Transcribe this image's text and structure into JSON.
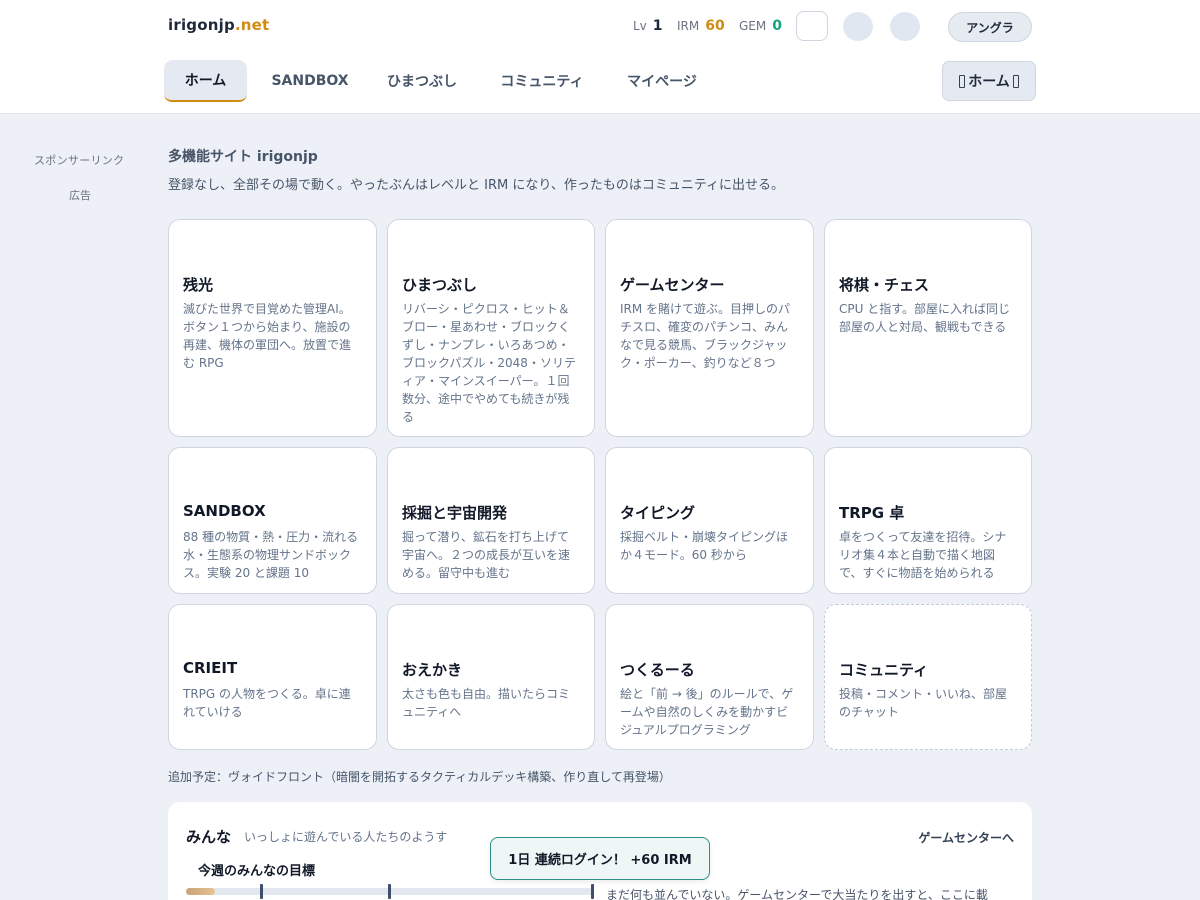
{
  "header": {
    "logo_main": "irigonjp",
    "logo_tld": ".net",
    "stats": {
      "lv_label": "Lv",
      "lv_value": "1",
      "irm_label": "IRM",
      "irm_value": "60",
      "gem_label": "GEM",
      "gem_value": "0"
    },
    "language_button": "アングラ",
    "nav": [
      "ホーム",
      "SANDBOX",
      "ひまつぶし",
      "コミュニティ",
      "マイページ"
    ],
    "active_nav": "ホーム",
    "home_dropdown": "ホーム"
  },
  "sidebar": {
    "sponsor_label": "スポンサーリンク",
    "ad_label": "広告"
  },
  "intro": {
    "title": "多機能サイト irigonjp",
    "description": "登録なし、全部その場で動く。やったぶんはレベルと IRM になり、作ったものはコミュニティに出せる。"
  },
  "cards": [
    {
      "title": "残光",
      "desc": "滅びた世界で目覚めた管理AI。ボタン１つから始まり、施設の再建、機体の軍団へ。放置で進む RPG"
    },
    {
      "title": "ひまつぶし",
      "desc": "リバーシ・ピクロス・ヒット＆ブロー・星あわせ・ブロックくずし・ナンプレ・いろあつめ・ブロックパズル・2048・ソリティア・マインスイーパー。１回数分、途中でやめても続きが残る"
    },
    {
      "title": "ゲームセンター",
      "desc": "IRM を賭けて遊ぶ。目押しのパチスロ、確変のパチンコ、みんなで見る競馬、ブラックジャック・ポーカー、釣りなど８つ"
    },
    {
      "title": "将棋・チェス",
      "desc": "CPU と指す。部屋に入れば同じ部屋の人と対局、観戦もできる"
    },
    {
      "title": "SANDBOX",
      "desc": "88 種の物質・熱・圧力・流れる水・生態系の物理サンドボックス。実験 20 と課題 10"
    },
    {
      "title": "採掘と宇宙開発",
      "desc": "掘って潜り、鉱石を打ち上げて宇宙へ。２つの成長が互いを速める。留守中も進む"
    },
    {
      "title": "タイピング",
      "desc": "採掘ベルト・崩壊タイピングほか４モード。60 秒から"
    },
    {
      "title": "TRPG 卓",
      "desc": "卓をつくって友達を招待。シナリオ集４本と自動で描く地図で、すぐに物語を始められる"
    },
    {
      "title": "CRIEIT",
      "desc": "TRPG の人物をつくる。卓に連れていける"
    },
    {
      "title": "おえかき",
      "desc": "太さも色も自由。描いたらコミュニティへ"
    },
    {
      "title": "つくるーる",
      "desc": "絵と「前 → 後」のルールで、ゲームや自然のしくみを動かすビジュアルプログラミング"
    },
    {
      "title": "コミュニティ",
      "desc": "投稿・コメント・いいね、部屋のチャット"
    }
  ],
  "coming_soon": "追加予定：ヴォイドフロント（暗闇を開拓するタクティカルデッキ構築、作り直して再登場）",
  "community_panel": {
    "title": "みんな",
    "subtitle": "いっしょに遊んでいる人たちのようす",
    "link": "ゲームセンターへ",
    "goal_title": "今週のみんなの目標",
    "goal_progress_fraction": 0.07,
    "empty_message": "まだ何も並んでいない。ゲームセンターで大当たりを出すと、ここに載"
  },
  "toast": "1日 連続ログイン！ +60 IRM",
  "colors": {
    "accent": "#d08b12",
    "gem": "#10a37f",
    "toast_border": "#2f8f89",
    "background": "#edf1f7"
  }
}
